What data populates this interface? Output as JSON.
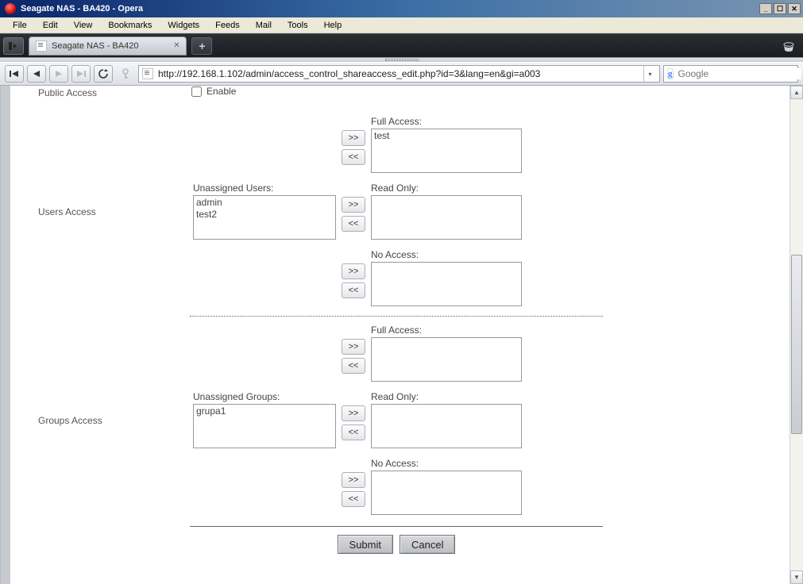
{
  "window": {
    "title": "Seagate NAS - BA420 - Opera"
  },
  "menu": {
    "items": [
      "File",
      "Edit",
      "View",
      "Bookmarks",
      "Widgets",
      "Feeds",
      "Mail",
      "Tools",
      "Help"
    ]
  },
  "tab": {
    "title": "Seagate NAS - BA420"
  },
  "address": {
    "url": "http://192.168.1.102/admin/access_control_shareaccess_edit.php?id=3&lang=en&gi=a003"
  },
  "search": {
    "placeholder": "Google"
  },
  "page": {
    "public_access_label": "Public Access",
    "enable_label": "Enable",
    "users_access_label": "Users Access",
    "groups_access_label": "Groups Access",
    "unassigned_users_label": "Unassigned Users:",
    "unassigned_groups_label": "Unassigned Groups:",
    "full_access_label": "Full Access:",
    "read_only_label": "Read Only:",
    "no_access_label": "No Access:",
    "move_right_label": ">>",
    "move_left_label": "<<",
    "submit_label": "Submit",
    "cancel_label": "Cancel",
    "unassigned_users": [
      "admin",
      "test2"
    ],
    "users_full_access": [
      "test"
    ],
    "users_read_only": [],
    "users_no_access": [],
    "unassigned_groups": [
      "grupa1"
    ],
    "groups_full_access": [],
    "groups_read_only": [],
    "groups_no_access": []
  }
}
